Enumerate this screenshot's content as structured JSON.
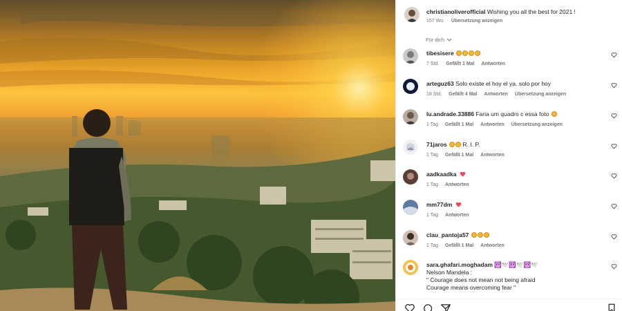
{
  "caption": {
    "username": "christianoliverofficial",
    "text": "Wishing you all the best for 2021 !",
    "age": "157 Wo.",
    "translate": "Übersetzung anzeigen"
  },
  "filter_label": "Für dich",
  "comments": [
    {
      "username": "tibesisere",
      "text": "",
      "emoji_count": 4,
      "age": "7 Std.",
      "likes": "Gefällt 1 Mal",
      "reply": "Antworten",
      "translate": ""
    },
    {
      "username": "arteguz63",
      "text": "Solo existe el hoy el ya. solo por hoy",
      "emoji_count": 0,
      "age": "18 Std.",
      "likes": "Gefällt 4 Mal",
      "reply": "Antworten",
      "translate": "Übersetzung anzeigen"
    },
    {
      "username": "lu.andrade.33886",
      "text": "Faria um quadro c essa foto",
      "emoji_count": 1,
      "age": "1 Tag",
      "likes": "Gefällt 1 Mal",
      "reply": "Antworten",
      "translate": "Übersetzung anzeigen"
    },
    {
      "username": "71jaros",
      "text": "R. I. P.",
      "emoji_count": 2,
      "age": "1 Tag",
      "likes": "Gefällt 1 Mal",
      "reply": "Antworten",
      "translate": ""
    },
    {
      "username": "aadkaadka",
      "text": "",
      "heart": true,
      "age": "1 Tag",
      "likes": "",
      "reply": "Antworten",
      "translate": ""
    },
    {
      "username": "mm77dm",
      "text": "",
      "heart": true,
      "age": "1 Tag",
      "likes": "",
      "reply": "Antworten",
      "translate": ""
    },
    {
      "username": "clau_pantoja57",
      "text": "",
      "emoji_count": 3,
      "age": "1 Tag",
      "likes": "Gefällt 1 Mal",
      "reply": "Antworten",
      "translate": ""
    },
    {
      "username": "sara.ghafari.moghadam",
      "text": "☮️🕊️☮️🕊️☮️🕊️",
      "lines": [
        "Nelson Mandela :",
        "\" Courage does not mean not being afraid",
        "Courage means overcoming fear \""
      ]
    }
  ],
  "icons": [
    "heart-icon",
    "comment-icon",
    "share-icon",
    "bookmark-icon",
    "chevron-down-icon"
  ],
  "colors": {
    "link": "#00376b",
    "muted": "#737373",
    "heart_red": "#ed4956",
    "text": "#262626"
  }
}
